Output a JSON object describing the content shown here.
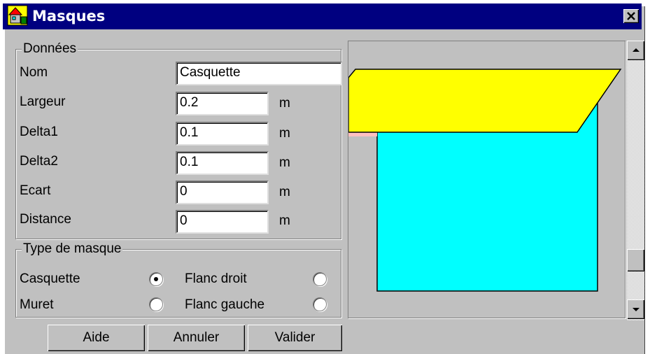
{
  "window": {
    "title": "Masques"
  },
  "donnees": {
    "legend": "Données",
    "nom": {
      "label": "Nom",
      "value": "Casquette"
    },
    "largeur": {
      "label": "Largeur",
      "value": "0.2",
      "unit": "m"
    },
    "delta1": {
      "label": "Delta1",
      "value": "0.1",
      "unit": "m"
    },
    "delta2": {
      "label": "Delta2",
      "value": "0.1",
      "unit": "m"
    },
    "ecart": {
      "label": "Ecart",
      "value": "0",
      "unit": "m"
    },
    "distance": {
      "label": "Distance",
      "value": "0",
      "unit": "m"
    }
  },
  "type_masque": {
    "legend": "Type de masque",
    "options": [
      {
        "label": "Casquette",
        "selected": true
      },
      {
        "label": "Flanc droit",
        "selected": false
      },
      {
        "label": "Muret",
        "selected": false
      },
      {
        "label": "Flanc gauche",
        "selected": false
      }
    ]
  },
  "buttons": {
    "aide": "Aide",
    "annuler": "Annuler",
    "valider": "Valider"
  },
  "preview": {
    "visor_color": "#ffff00",
    "wall_color": "#00ffff"
  }
}
